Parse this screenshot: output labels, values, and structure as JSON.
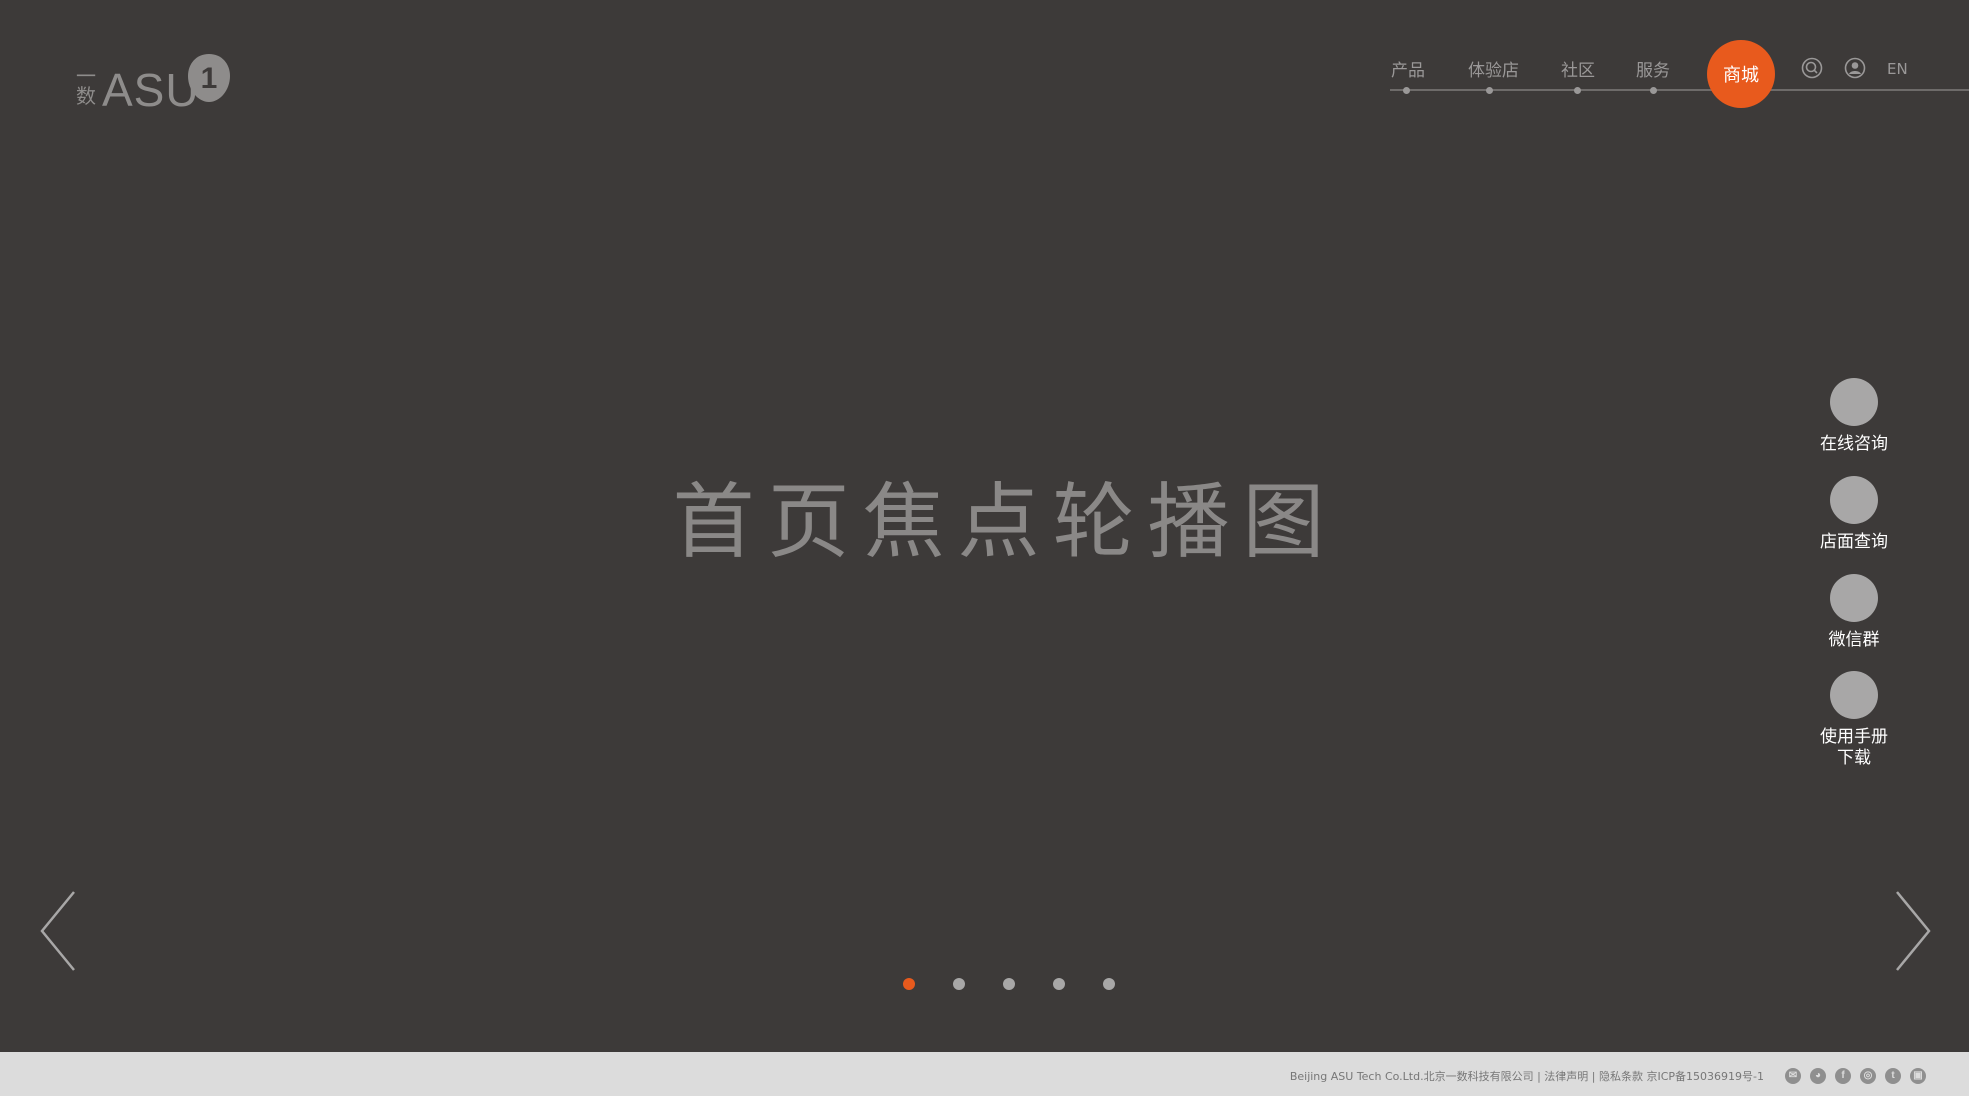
{
  "logo": {
    "small_top": "一",
    "small_bottom": "数",
    "word": "ASU",
    "mark_glyph": "1"
  },
  "nav": {
    "items": [
      {
        "label": "产品"
      },
      {
        "label": "体验店"
      },
      {
        "label": "社区"
      },
      {
        "label": "服务"
      }
    ],
    "shop_label": "商城",
    "lang_label": "EN"
  },
  "hero": {
    "title": "首页焦点轮播图",
    "slide_count": 5,
    "active_slide": 1
  },
  "side": {
    "items": [
      {
        "label": "在线咨询"
      },
      {
        "label": "店面查询"
      },
      {
        "label": "微信群"
      },
      {
        "label": "使用手册",
        "label2": "下载"
      }
    ]
  },
  "footer": {
    "text": "Beijing ASU Tech Co.Ltd.北京一数科技有限公司 | 法律声明 | 隐私条款   京ICP备15036919号-1",
    "social_icons": [
      "mail-icon",
      "wechat-icon",
      "facebook-icon",
      "weibo-icon",
      "twitter-icon",
      "youku-icon"
    ]
  },
  "colors": {
    "background": "#3d3a39",
    "accent": "#e85a1d",
    "footer_bg": "#dcdcdc"
  }
}
